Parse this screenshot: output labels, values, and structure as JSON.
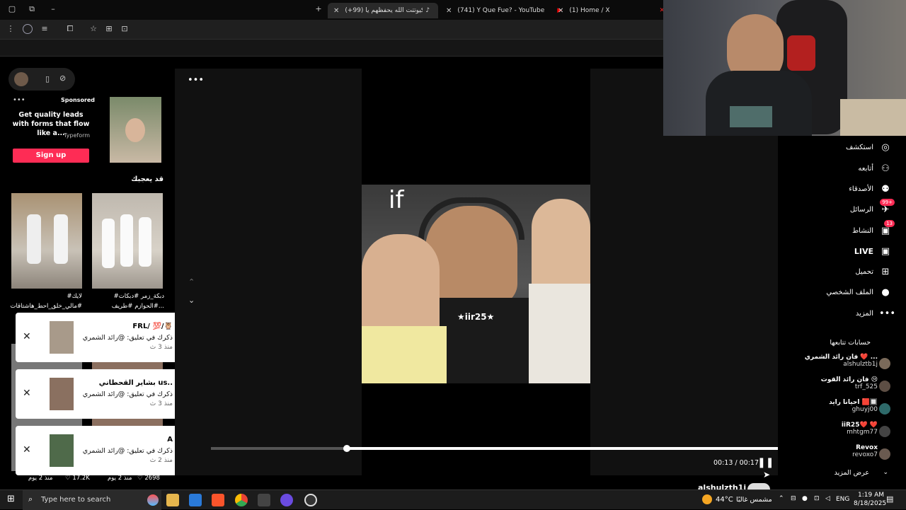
{
  "tabs": [
    {
      "label": "(+99) كيوتتت الله يحفظهم يا...",
      "active": true
    },
    {
      "label": "(741) Y Que Fue? - YouTube"
    },
    {
      "label": "(1) Home / X"
    }
  ],
  "left": {
    "sponsored_label": "Sponsored",
    "ad_text": "Get quality leads with forms that flow like a...",
    "ad_brand": "Typeform",
    "signup_label": "Sign up",
    "you_may_like": "قد يعجبك",
    "video1_caption": "#لايك #مالي_خلق_احط_هاشتاقات",
    "video2_caption": "#دبكة_زمر #دبكات #الحوازم #طريف...",
    "video3_stats": "17.2K",
    "video3_time": "منذ 2 يوم",
    "video4_stats": "2698",
    "video4_time": "منذ 2 يوم"
  },
  "notifications": [
    {
      "title": "FRL/ 💯/🦉",
      "message": "ذكرك في تعليق: @رائد الشمري",
      "time": "منذ 3 ث"
    },
    {
      "title": "بشاير القحطاني us..",
      "message": "ذكرك في تعليق: @رائد الشمري",
      "time": "منذ 3 ث"
    },
    {
      "title": "A",
      "message": "ذكرك في تعليق: @رائد الشمري",
      "time": "منذ 2 ث"
    }
  ],
  "video": {
    "overlay_if": "if",
    "watermark": "★iir25★",
    "time_display": "00:13 / 00:17",
    "progress": 0.76,
    "author_handle": "alshulzth1j"
  },
  "nav": [
    {
      "label": "استكشف",
      "icon": "compass-icon"
    },
    {
      "label": "أتابعه",
      "icon": "user-follow-icon"
    },
    {
      "label": "الأصدقاء",
      "icon": "friends-icon"
    },
    {
      "label": "الرسائل",
      "icon": "message-icon",
      "badge": "99+"
    },
    {
      "label": "النشاط",
      "icon": "activity-icon",
      "badge": "13"
    },
    {
      "label": "LIVE",
      "icon": "live-icon"
    },
    {
      "label": "تحميل",
      "icon": "upload-icon"
    },
    {
      "label": "الملف الشخصي",
      "icon": "profile-icon"
    },
    {
      "label": "المزيد",
      "icon": "more-icon"
    }
  ],
  "following_title": "حسابات تتابعها",
  "following": [
    {
      "name": "فان رائد الشمري ❤️ ...",
      "user": "alshulztb1j"
    },
    {
      "name": "فان رائد القوت 😢",
      "user": "trf_525"
    },
    {
      "name": "احيانا رايد 🟥🔲",
      "user": "ghuyj00"
    },
    {
      "name": "iiR25❤️ ❤️",
      "user": "mhtgm77"
    },
    {
      "name": "Revox",
      "user": "revoxo7"
    }
  ],
  "see_more": "عرض المزيد",
  "taskbar": {
    "search_placeholder": "Type here to search",
    "weather": "44°C",
    "weather_desc": "مشمس غالبًا",
    "lang": "ENG",
    "time": "1:19 AM",
    "date": "8/18/2025"
  }
}
